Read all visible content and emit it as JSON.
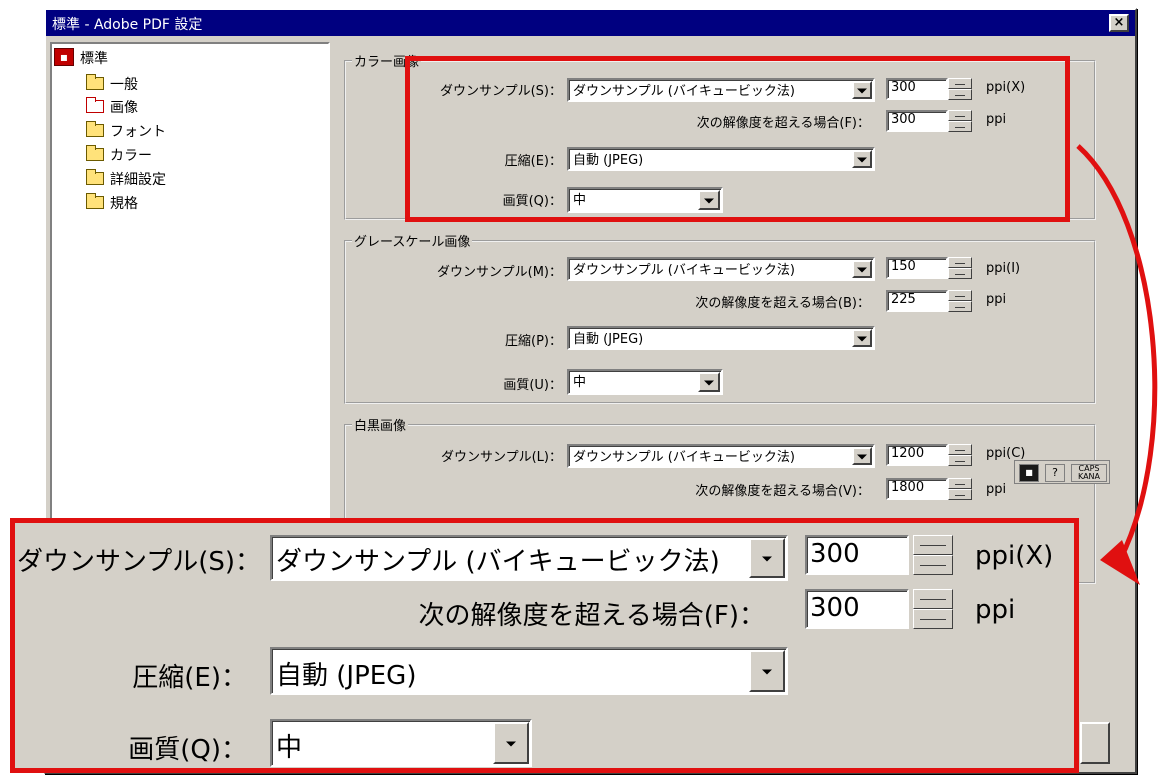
{
  "window": {
    "title": "標準 - Adobe PDF 設定",
    "close_label": "×"
  },
  "tree": {
    "root": "標準",
    "items": [
      "一般",
      "画像",
      "フォント",
      "カラー",
      "詳細設定",
      "規格"
    ],
    "selected": "画像"
  },
  "color": {
    "title": "カラー画像",
    "downsample_label": "ダウンサンプル(S)：",
    "downsample_value": "ダウンサンプル (バイキュービック法)",
    "ppi_value": "300",
    "ppi_unit": "ppi(X)",
    "threshold_label": "次の解像度を超える場合(F)：",
    "threshold_value": "300",
    "threshold_unit": "ppi",
    "compression_label": "圧縮(E)：",
    "compression_value": "自動 (JPEG)",
    "quality_label": "画質(Q)：",
    "quality_value": "中"
  },
  "gray": {
    "title": "グレースケール画像",
    "downsample_label": "ダウンサンプル(M)：",
    "downsample_value": "ダウンサンプル (バイキュービック法)",
    "ppi_value": "150",
    "ppi_unit": "ppi(I)",
    "threshold_label": "次の解像度を超える場合(B)：",
    "threshold_value": "225",
    "threshold_unit": "ppi",
    "compression_label": "圧縮(P)：",
    "compression_value": "自動 (JPEG)",
    "quality_label": "画質(U)：",
    "quality_value": "中"
  },
  "mono": {
    "title": "白黒画像",
    "downsample_label": "ダウンサンプル(L)：",
    "downsample_value": "ダウンサンプル (バイキュービック法)",
    "ppi_value": "1200",
    "ppi_unit": "ppi(C)",
    "threshold_label": "次の解像度を超える場合(V)：",
    "threshold_value": "1800",
    "threshold_unit": "ppi"
  },
  "zoom": {
    "downsample_label": "ダウンサンプル(S)：",
    "downsample_value": "ダウンサンプル (バイキュービック法)",
    "ppi_value": "300",
    "ppi_unit": "ppi(X)",
    "threshold_label": "次の解像度を超える場合(F)：",
    "threshold_value": "300",
    "threshold_unit": "ppi",
    "compression_label": "圧縮(E)：",
    "compression_value": "自動 (JPEG)",
    "quality_label": "画質(Q)：",
    "quality_value": "中"
  },
  "ime": {
    "caps": "CAPS",
    "kana": "KANA",
    "help": "?"
  },
  "colors": {
    "titlebar": "#000080",
    "dialog": "#d4d0c8",
    "highlight": "#e01010"
  }
}
